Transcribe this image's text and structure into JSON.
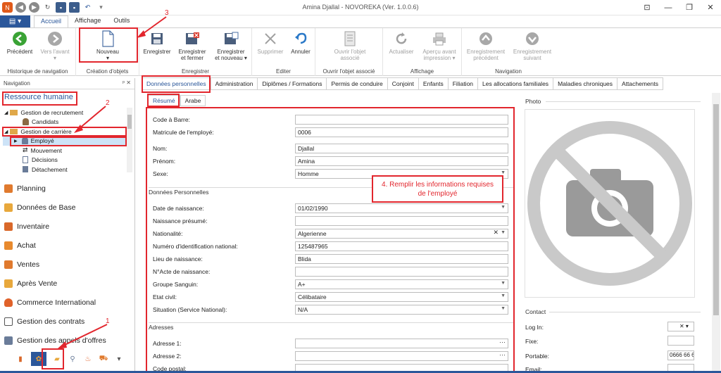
{
  "window": {
    "title": "Amina Djallal - NOVOREKA (Ver. 1.0.0.6)"
  },
  "ribbon_tabs": [
    "Accueil",
    "Affichage",
    "Outils"
  ],
  "file_icon": "menu-icon",
  "ribbon": {
    "groups": {
      "nav_history": "Historique de navigation",
      "create": "Création d'objets",
      "save": "Enregistrer",
      "edit": "Editer",
      "open": "Ouvrir l'objet associé",
      "display": "Affichage",
      "navigation": "Navigation"
    },
    "buttons": {
      "previous": "Précédent",
      "forward": "Vers l'avant",
      "new": "Nouveau",
      "save": "Enregistrer",
      "save_close_1": "Enregistrer",
      "save_close_2": "et fermer",
      "save_new_1": "Enregistrer",
      "save_new_2": "et nouveau",
      "delete": "Supprimer",
      "cancel": "Annuler",
      "open_obj_1": "Ouvrir l'objet",
      "open_obj_2": "associé",
      "refresh": "Actualiser",
      "preview_1": "Aperçu avant",
      "preview_2": "impression",
      "prev_record_1": "Enregistrement",
      "prev_record_2": "précédent",
      "next_record_1": "Enregistrement",
      "next_record_2": "suivant"
    }
  },
  "nav": {
    "header": "Navigation",
    "pins": "ᵖ ✕",
    "section_title": "Ressource humaine",
    "tree": [
      "Gestion de recrutement",
      "Candidats",
      "Gestion de carrière",
      "Employé",
      "Mouvement",
      "Décisions",
      "Détachement"
    ],
    "modules": [
      "Planning",
      "Données de Base",
      "Inventaire",
      "Achat",
      "Ventes",
      "Après Vente",
      "Commerce International",
      "Gestion des contrats",
      "Gestion des appels d'offres"
    ]
  },
  "content_tabs": [
    "Données personnelles",
    "Administration",
    "Diplômes / Formations",
    "Permis de conduire",
    "Conjoint",
    "Enfants",
    "Filiation",
    "Les allocations familiales",
    "Maladies chroniques",
    "Attachements"
  ],
  "sub_tabs": [
    "Résumé",
    "Arabe"
  ],
  "form": {
    "top": [
      {
        "label": "Code à Barre:",
        "value": ""
      },
      {
        "label": "Matricule de l'employé:",
        "value": "0006"
      },
      {
        "label": "Nom:",
        "value": "Djallal"
      },
      {
        "label": "Prénom:",
        "value": "Amina"
      },
      {
        "label": "Sexe:",
        "value": "Homme"
      }
    ],
    "section_personal": "Données Personnelles",
    "personal": [
      {
        "label": "Date de naissance:",
        "value": "01/02/1990"
      },
      {
        "label": "Naissance présumé:",
        "value": ""
      },
      {
        "label": "Nationalité:",
        "value": "Algerienne"
      },
      {
        "label": "Numéro d'identification national:",
        "value": "125487965"
      },
      {
        "label": "Lieu de naissance:",
        "value": "Blida"
      },
      {
        "label": "N°Acte de naissance:",
        "value": ""
      },
      {
        "label": "Groupe Sanguin:",
        "value": "A+"
      },
      {
        "label": "Etat civil:",
        "value": "Célibataire"
      },
      {
        "label": "Situation (Service National):",
        "value": "N/A"
      }
    ],
    "section_address": "Adresses",
    "address": [
      {
        "label": "Adresse 1:",
        "value": ""
      },
      {
        "label": "Adresse 2:",
        "value": ""
      },
      {
        "label": "Code postal:",
        "value": ""
      }
    ]
  },
  "photo": {
    "label": "Photo"
  },
  "contact": {
    "label": "Contact",
    "fields": [
      {
        "label": "Log In:",
        "value": ""
      },
      {
        "label": "Fixe:",
        "value": ""
      },
      {
        "label": "Portable:",
        "value": "0666 66 6"
      },
      {
        "label": "Email:",
        "value": ""
      }
    ]
  },
  "annotations": {
    "n1": "1",
    "n2": "2",
    "n3": "3",
    "note_line1": "4. Remplir les informations requises",
    "note_line2": "de l'employé"
  },
  "colors": {
    "accent": "#2b579a",
    "annotation": "#e2262d"
  }
}
